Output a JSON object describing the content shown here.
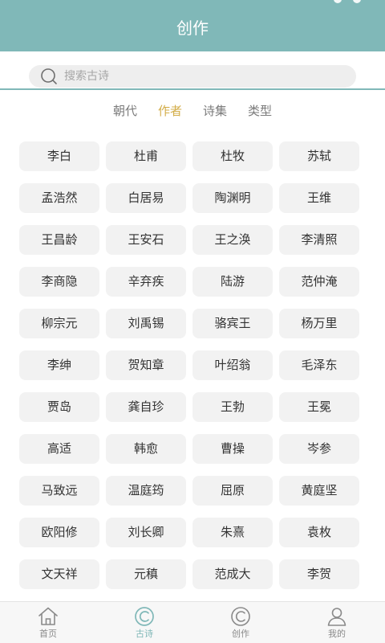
{
  "header": {
    "title": "创作"
  },
  "search": {
    "placeholder": "搜索古诗"
  },
  "tabs": [
    {
      "label": "朝代",
      "active": false
    },
    {
      "label": "作者",
      "active": true
    },
    {
      "label": "诗集",
      "active": false
    },
    {
      "label": "类型",
      "active": false
    }
  ],
  "poets": [
    "李白",
    "杜甫",
    "杜牧",
    "苏轼",
    "孟浩然",
    "白居易",
    "陶渊明",
    "王维",
    "王昌龄",
    "王安石",
    "王之涣",
    "李清照",
    "李商隐",
    "辛弃疾",
    "陆游",
    "范仲淹",
    "柳宗元",
    "刘禹锡",
    "骆宾王",
    "杨万里",
    "李绅",
    "贺知章",
    "叶绍翁",
    "毛泽东",
    "贾岛",
    "龚自珍",
    "王勃",
    "王冕",
    "高适",
    "韩愈",
    "曹操",
    "岑参",
    "马致远",
    "温庭筠",
    "屈原",
    "黄庭坚",
    "欧阳修",
    "刘长卿",
    "朱熹",
    "袁枚",
    "文天祥",
    "元稹",
    "范成大",
    "李贺"
  ],
  "nav": [
    {
      "label": "首页",
      "icon": "home-icon",
      "active": false
    },
    {
      "label": "古诗",
      "icon": "poem-icon",
      "active": true
    },
    {
      "label": "创作",
      "icon": "create-icon",
      "active": false
    },
    {
      "label": "我的",
      "icon": "user-icon",
      "active": false
    }
  ],
  "colors": {
    "accent": "#80b8b8",
    "active_tab": "#d3ad49",
    "chip_background": "#f2f2f2",
    "inactive_text": "#7a7a7a"
  }
}
